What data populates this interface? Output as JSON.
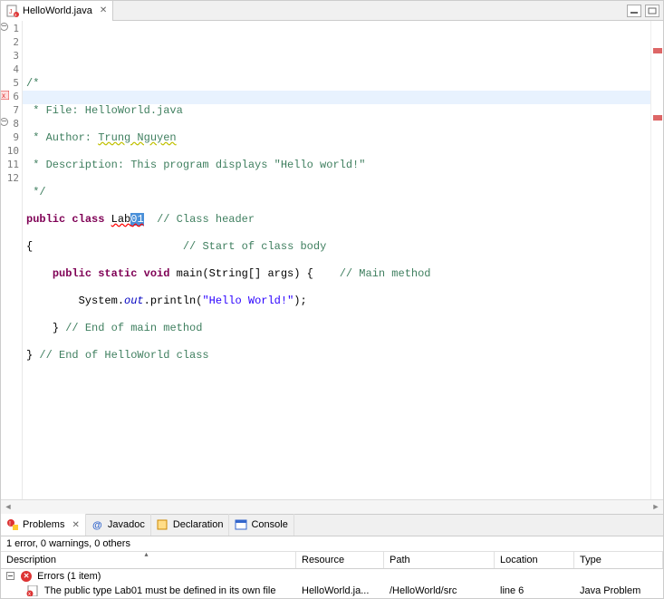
{
  "editor": {
    "tab_title": "HelloWorld.java",
    "lines": {
      "l1": "/*",
      "l2": " * File: HelloWorld.java",
      "l3_pre": " * Author: ",
      "l3_name": "Trung Nguyen",
      "l4": " * Description: This program displays \"Hello world!\"",
      "l5": " */",
      "l6_kw1": "public",
      "l6_kw2": "class",
      "l6_name_pre": "Lab",
      "l6_name_sel": "01",
      "l6_comment": "// Class header",
      "l7_brace": "{",
      "l7_comment": "// Start of class body",
      "l8_kw": "public static void",
      "l8_main": " main(String[] args) {",
      "l8_comment": "// Main method",
      "l9_sys": "System.",
      "l9_out": "out",
      "l9_print": ".println(",
      "l9_str": "\"Hello World!\"",
      "l9_end": ");",
      "l10_brace": "}",
      "l10_comment": "// End of main method",
      "l11_brace": "}",
      "l11_comment": "// End of HelloWorld class"
    },
    "line_numbers": [
      "1",
      "2",
      "3",
      "4",
      "5",
      "6",
      "7",
      "8",
      "9",
      "10",
      "11",
      "12"
    ]
  },
  "views": {
    "problems": "Problems",
    "javadoc": "Javadoc",
    "declaration": "Declaration",
    "console": "Console"
  },
  "problems": {
    "status": "1 error, 0 warnings, 0 others",
    "columns": {
      "description": "Description",
      "resource": "Resource",
      "path": "Path",
      "location": "Location",
      "type": "Type"
    },
    "errors_group": "Errors (1 item)",
    "items": [
      {
        "description": "The public type Lab01 must be defined in its own file",
        "resource": "HelloWorld.ja...",
        "path": "/HelloWorld/src",
        "location": "line 6",
        "type": "Java Problem"
      }
    ]
  }
}
